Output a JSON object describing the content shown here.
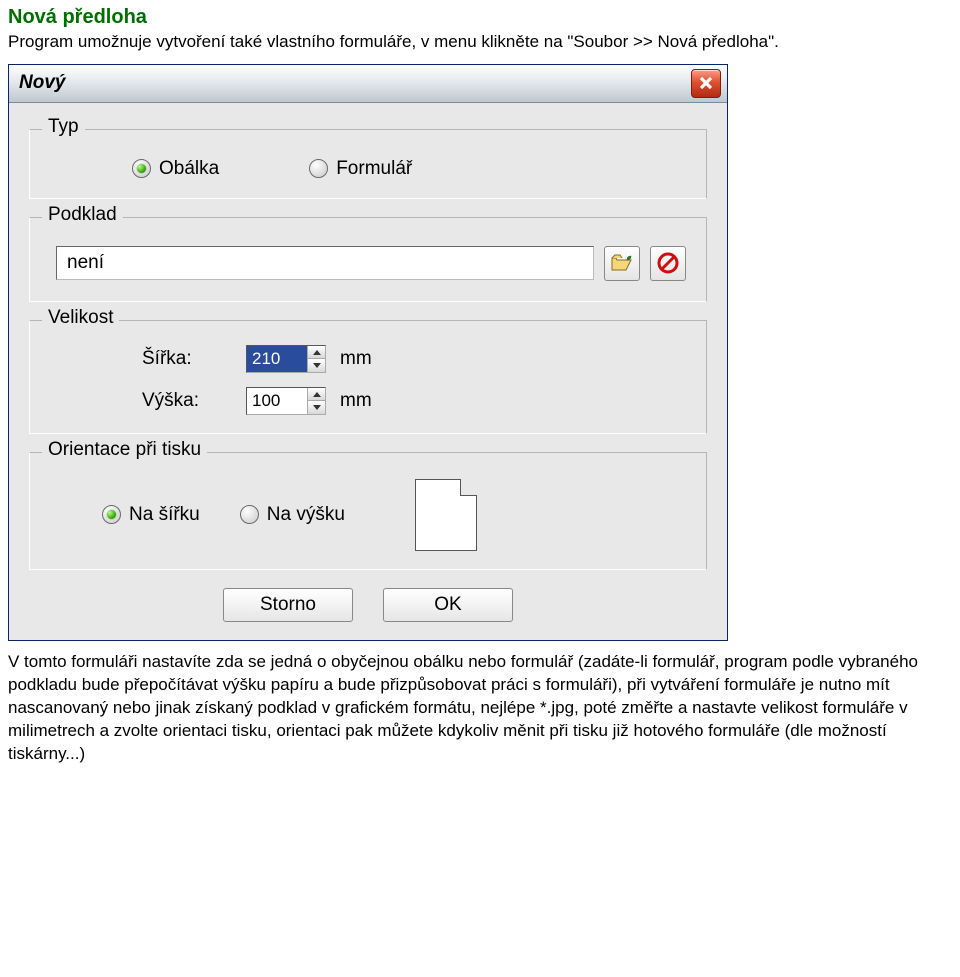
{
  "doc": {
    "heading": "Nová předloha",
    "intro": "Program umožnuje vytvoření také vlastního formuláře, v menu klikněte na \"Soubor >> Nová předloha\".",
    "outro": "V tomto formuláři nastavíte zda se jedná o obyčejnou obálku nebo formulář (zadáte-li formulář, program podle vybraného podkladu bude přepočítávat výšku papíru a bude přizpůsobovat práci s formuláři), při vytváření formuláře je nutno mít nascanovaný nebo jinak získaný podklad v grafickém formátu, nejlépe *.jpg, poté změřte a nastavte velikost formuláře v milimetrech a zvolte orientaci tisku, orientaci pak můžete kdykoliv měnit při tisku již hotového formuláře (dle možností tiskárny...)"
  },
  "dialog": {
    "title": "Nový",
    "groups": {
      "typ": {
        "legend": "Typ",
        "options": {
          "obalka": "Obálka",
          "formular": "Formulář"
        },
        "selected": "obalka"
      },
      "podklad": {
        "legend": "Podklad",
        "value": "není"
      },
      "velikost": {
        "legend": "Velikost",
        "width_label": "Šířka:",
        "height_label": "Výška:",
        "width_value": "210",
        "height_value": "100",
        "unit": "mm"
      },
      "orientace": {
        "legend": "Orientace při tisku",
        "options": {
          "sirku": "Na šířku",
          "vysku": "Na výšku"
        },
        "selected": "sirku"
      }
    },
    "buttons": {
      "cancel": "Storno",
      "ok": "OK"
    }
  }
}
